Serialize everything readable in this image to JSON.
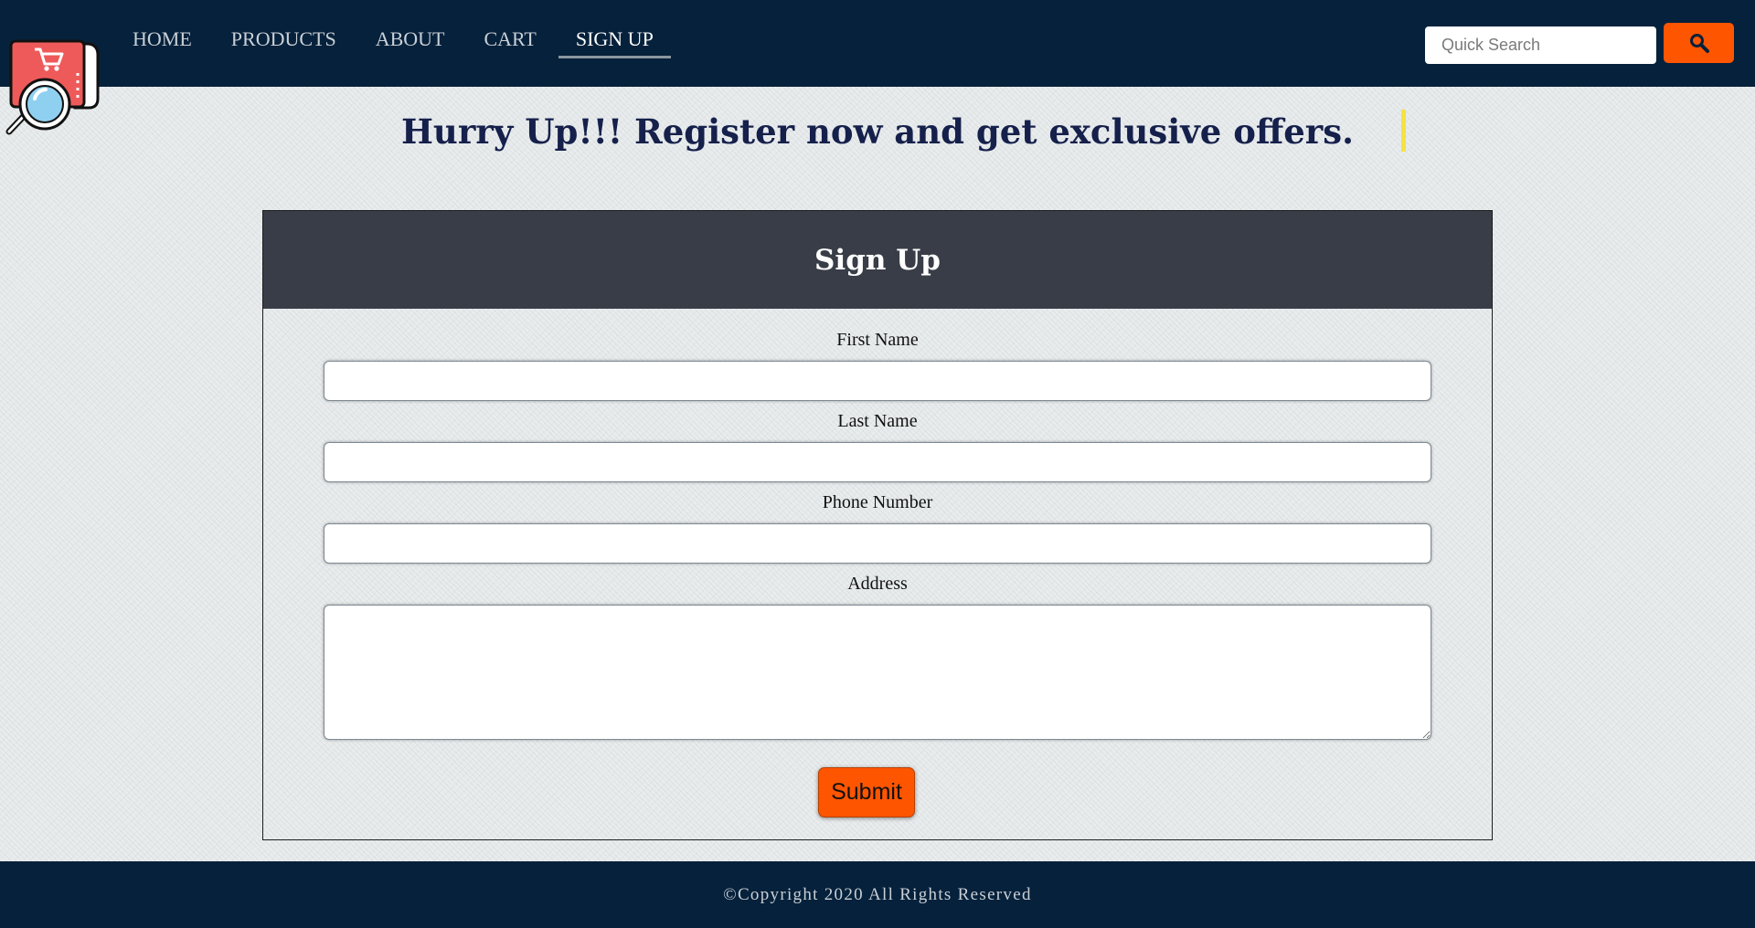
{
  "nav": {
    "items": [
      {
        "label": "HOME"
      },
      {
        "label": "PRODUCTS"
      },
      {
        "label": "ABOUT"
      },
      {
        "label": "CART"
      },
      {
        "label": "SIGN UP"
      }
    ],
    "active": "SIGN UP"
  },
  "search": {
    "placeholder": "Quick Search",
    "icon": "search-icon"
  },
  "logo": {
    "icon": "shop-magnifier-icon"
  },
  "headline": "Hurry Up!!! Register now and get exclusive offers.",
  "form": {
    "title": "Sign Up",
    "first_name_label": "First Name",
    "last_name_label": "Last Name",
    "phone_label": "Phone Number",
    "address_label": "Address",
    "submit_label": "Submit"
  },
  "footer": {
    "text": "©Copyright 2020 All Rights Reserved"
  },
  "colors": {
    "navbar": "#06213b",
    "accent": "#fe5500",
    "card_header": "#383d47",
    "headline": "#15204b"
  }
}
